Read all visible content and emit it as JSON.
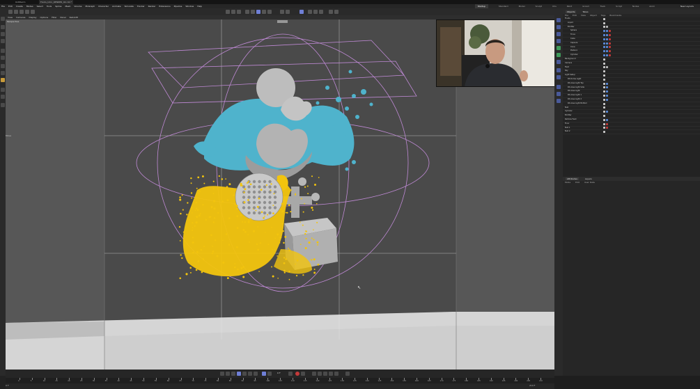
{
  "titlebar": {
    "tabs": [
      "Untitled 1",
      "Fluids_Intro_RENDER_02.c4d *"
    ]
  },
  "menubar": {
    "items": [
      "File",
      "Edit",
      "Create",
      "Modes",
      "Select",
      "Tools",
      "Spline",
      "Mesh",
      "Volume",
      "MoGraph",
      "Character",
      "Animate",
      "Simulate",
      "Tracker",
      "Render",
      "Extensions",
      "Pipeline",
      "Window",
      "Help"
    ],
    "layouts": [
      "Startup",
      "Standard",
      "Model",
      "Sculpt",
      "UVs",
      "Paint",
      "Groom",
      "Track",
      "Script",
      "Nodes",
      "Anim"
    ],
    "active_layout": "Startup",
    "new_layouts_label": "New Layouts"
  },
  "viewport": {
    "menu": [
      "View",
      "Cameras",
      "Display",
      "Options",
      "Filter",
      "Panel",
      "Redshift"
    ],
    "label": "Perspective",
    "mode_label": "Move"
  },
  "objects_panel": {
    "tabs": [
      "Objects",
      "Takes"
    ],
    "menu": [
      "File",
      "Edit",
      "View",
      "Object",
      "Tags",
      "Bookmarks"
    ],
    "rows": [
      {
        "name": "Fluids",
        "indent": 0,
        "tags": [
          "#ccc"
        ]
      },
      {
        "name": "Liquid",
        "indent": 1,
        "tags": [
          "#ccc"
        ]
      },
      {
        "name": "Emitter",
        "indent": 1,
        "tags": [
          "#ccc",
          "#bbb"
        ]
      },
      {
        "name": "Sphere",
        "indent": 2,
        "tags": [
          "#5a8ad8",
          "#5a8ad8",
          "#c23b3b"
        ]
      },
      {
        "name": "Torus",
        "indent": 2,
        "tags": [
          "#5a8ad8",
          "#5a8ad8",
          "#c23b3b"
        ]
      },
      {
        "name": "Cube",
        "indent": 2,
        "tags": [
          "#5a8ad8",
          "#5a8ad8",
          "#c23b3b"
        ]
      },
      {
        "name": "Capsule",
        "indent": 2,
        "tags": [
          "#5a8ad8",
          "#5a8ad8",
          "#c23b3b"
        ]
      },
      {
        "name": "Cone",
        "indent": 2,
        "tags": [
          "#5a8ad8",
          "#5a8ad8",
          "#c23b3b"
        ]
      },
      {
        "name": "Platonic",
        "indent": 2,
        "tags": [
          "#5a8ad8",
          "#5a8ad8",
          "#c23b3b"
        ]
      },
      {
        "name": "Cylinder",
        "indent": 2,
        "tags": [
          "#5a8ad8",
          "#5a8ad8",
          "#c23b3b"
        ]
      },
      {
        "name": "Background",
        "indent": 0,
        "tags": [
          "#ccc"
        ]
      },
      {
        "name": "Camera",
        "indent": 0,
        "tags": [
          "#ccc"
        ]
      },
      {
        "name": "Field",
        "indent": 0,
        "tags": [
          "#ccc",
          "#bbb"
        ]
      },
      {
        "name": "Sky",
        "indent": 0,
        "tags": [
          "#ccc"
        ]
      },
      {
        "name": "Light Setup",
        "indent": 0,
        "tags": [
          "#ccc"
        ]
      },
      {
        "name": "RS Dome Light",
        "indent": 1,
        "tags": [
          "#ccc"
        ]
      },
      {
        "name": "RS Area Light Top",
        "indent": 1,
        "tags": [
          "#ccc",
          "#5a8ad8"
        ]
      },
      {
        "name": "RS Area Light Side",
        "indent": 1,
        "tags": [
          "#ccc",
          "#5a8ad8"
        ]
      },
      {
        "name": "RS Area Light",
        "indent": 1,
        "tags": [
          "#ccc",
          "#5a8ad8"
        ]
      },
      {
        "name": "RS Area Light 1",
        "indent": 1,
        "tags": [
          "#ccc",
          "#5a8ad8"
        ]
      },
      {
        "name": "RS Area Light 2",
        "indent": 1,
        "tags": [
          "#ccc",
          "#5a8ad8"
        ]
      },
      {
        "name": "RS Area Light Bottom",
        "indent": 1,
        "tags": [
          "#ccc"
        ]
      },
      {
        "name": "Null",
        "indent": 0,
        "tags": [
          "#ccc"
        ]
      },
      {
        "name": "Cylinder",
        "indent": 0,
        "tags": [
          "#ccc",
          "#5a8ad8"
        ]
      },
      {
        "name": "Emitter",
        "indent": 0,
        "tags": [
          "#ccc"
        ]
      },
      {
        "name": "Particle Field",
        "indent": 0,
        "tags": [
          "#ccc",
          "#5a8ad8"
        ]
      },
      {
        "name": "Floor",
        "indent": 0,
        "tags": [
          "#ccc",
          "#c23b3b"
        ]
      },
      {
        "name": "Null 1",
        "indent": 0,
        "tags": [
          "#ccc",
          "#c23b3b"
        ]
      },
      {
        "name": "Null 2",
        "indent": 0,
        "tags": [
          "#ccc"
        ]
      }
    ]
  },
  "attributes_panel": {
    "tabs": [
      "Attributes",
      "Layers"
    ],
    "menu": [
      "Mode",
      "Edit",
      "User Data"
    ]
  },
  "timeline": {
    "ticks": [
      "0",
      "5",
      "10",
      "15",
      "20",
      "25",
      "30",
      "35",
      "40",
      "45",
      "50",
      "55",
      "60",
      "65",
      "70",
      "75",
      "80",
      "85",
      "90",
      "95",
      "100",
      "105",
      "110",
      "115",
      "120",
      "125",
      "130",
      "135",
      "140",
      "145",
      "150",
      "155",
      "160",
      "165",
      "170",
      "175",
      "180",
      "185",
      "190",
      "195",
      "200",
      "205",
      "210"
    ],
    "frame_start": "0 F",
    "frame_end": "210 F",
    "current_frame": "0 F"
  },
  "colors": {
    "accent": "#6f7fd6",
    "liquid": "#4fb3cc",
    "particles": "#f2c40e",
    "guide": "#c08ad6"
  }
}
